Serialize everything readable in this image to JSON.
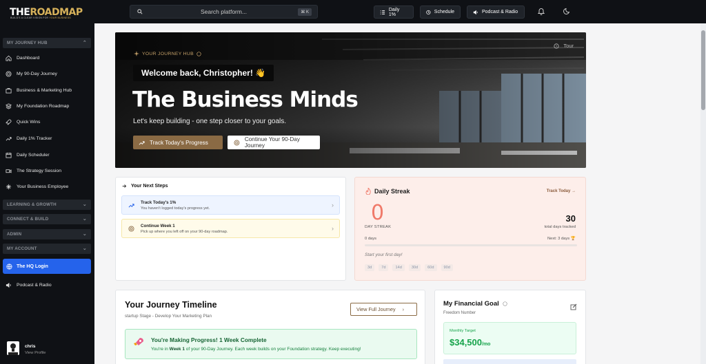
{
  "brand": {
    "name_part1": "THE",
    "name_part2": "ROADMAP",
    "tagline_part1": "BUILD'S A CLEAR VISION FOR ",
    "tagline_part2": "YOUR BUSINESS"
  },
  "search": {
    "placeholder": "Search platform...",
    "shortcut": "⌘ K"
  },
  "topbar": {
    "daily": "Daily 1%",
    "schedule": "Schedule",
    "podcast": "Podcast & Radio"
  },
  "sidebar": {
    "section1": "MY JOURNEY HUB",
    "items": [
      {
        "label": "Dashboard"
      },
      {
        "label": "My 90-Day Journey"
      },
      {
        "label": "Business & Marketing Hub"
      },
      {
        "label": "My Foundation Roadmap"
      },
      {
        "label": "Quick Wins"
      },
      {
        "label": "Daily 1% Tracker"
      },
      {
        "label": "Daily Scheduler"
      },
      {
        "label": "The Strategy Session"
      },
      {
        "label": "Your Business Employee"
      }
    ],
    "section2": "LEARNING & GROWTH",
    "section3": "CONNECT & BUILD",
    "section4": "ADMIN",
    "section5": "MY ACCOUNT",
    "active": "The HQ Login",
    "podcast": "Podcast & Radio",
    "profile": {
      "name": "chris",
      "sub": "View Profile"
    }
  },
  "hero": {
    "kicker": "YOUR JOURNEY HUB",
    "tour": "Tour",
    "welcome": "Welcome back, Christopher! 👋",
    "title": "The Business Minds",
    "subtitle": "Let's keep building - one step closer to your goals.",
    "btn_primary": "Track Today's Progress",
    "btn_secondary": "Continue Your 90-Day Journey"
  },
  "next_steps": {
    "title": "Your Next Steps",
    "items": [
      {
        "title": "Track Today's 1%",
        "sub": "You haven't logged today's progress yet."
      },
      {
        "title": "Continue Week 1",
        "sub": "Pick up where you left off on your 90-day roadmap."
      }
    ]
  },
  "streak": {
    "title": "Daily Streak",
    "link": "Track Today →",
    "value": "0",
    "label": "DAY STREAK",
    "total": "30",
    "total_label": "total days tracked",
    "days": "0 days",
    "next": "Next: 3 days 🏆",
    "progress": 0,
    "start": "Start your first day!",
    "pills": [
      "3d",
      "7d",
      "14d",
      "30d",
      "60d",
      "90d"
    ]
  },
  "timeline": {
    "title": "Your Journey Timeline",
    "subtitle": "startup Stage - Develop Your Marketing Plan",
    "button": "View Full Journey",
    "banner_title": "You're Making Progress! 1 Week Complete",
    "banner_pre": "You're in ",
    "banner_bold": "Week 1",
    "banner_post": " of your 90-Day Journey. Each week builds on your Foundation strategy. Keep executing!"
  },
  "financial": {
    "title": "My Financial Goal",
    "subtitle": "Freedom Number",
    "target_label": "Monthly Target",
    "target_value": "$34,500",
    "target_unit": "/mo"
  },
  "colors": {
    "accent_gold": "#8a6a44",
    "active_blue": "#2563eb",
    "streak_red": "#f07a6a",
    "success_green": "#16a34a"
  }
}
